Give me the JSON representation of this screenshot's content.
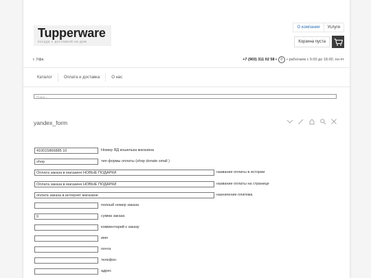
{
  "header": {
    "logo_word": "Tupperware",
    "logo_tagline": "посуда с доставкой на дом",
    "links": [
      "О компании",
      "Услуги"
    ],
    "cart_label": "Корзина пуста",
    "city": "г. Уфа",
    "phone": "+7 (903) 311 02 58 •",
    "hours": "• работаем с 9.00 до 18.00, пн-пт"
  },
  "nav": {
    "items": [
      "Каталог",
      "Оплата и доставка",
      "О нас"
    ]
  },
  "search": {
    "placeholder": "Поиск..."
  },
  "form": {
    "title": "yandex_form",
    "tools": [
      "chevron-down-icon",
      "pencil-icon",
      "home-icon",
      "zoom-icon",
      "close-icon"
    ],
    "rows": [
      {
        "value": "410015866885 10",
        "label": "Номер ЯД кошелька магазина"
      },
      {
        "value": "shop",
        "label": "тип формы оплаты (shop donate small )"
      },
      {
        "value": "Оплата заказа в магазине НОВЫЕ ПОДАРКИ",
        "label": "название оплаты в истории"
      },
      {
        "value": "Оплата заказа в магазине НОВЫЕ ПОДАРКИ",
        "label": "название оплаты на странице"
      },
      {
        "value": "оплата заказа в интернет магазине",
        "label": "назначение платежа"
      },
      {
        "value": "",
        "label": "полный номер заказа"
      },
      {
        "value": "0",
        "label": "сумма заказа"
      },
      {
        "value": "",
        "label": "комментарий к заказу"
      },
      {
        "value": "",
        "label": "имя"
      },
      {
        "value": "",
        "label": "почта"
      },
      {
        "value": "",
        "label": "телефон"
      },
      {
        "value": "",
        "label": "адрес"
      }
    ]
  }
}
